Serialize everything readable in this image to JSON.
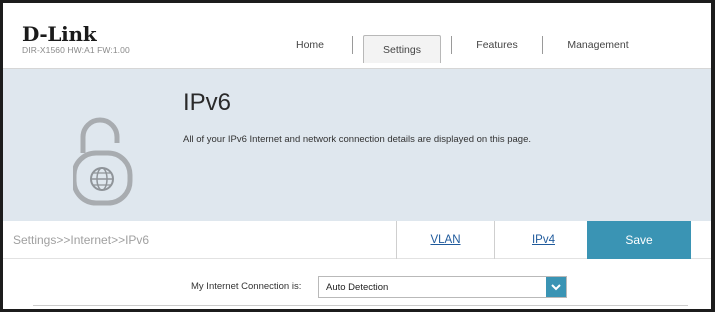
{
  "header": {
    "logo_text": "D-Link",
    "model_text": "DIR-X1560 HW:A1 FW:1.00",
    "nav": {
      "home": "Home",
      "settings": "Settings",
      "features": "Features",
      "management": "Management"
    },
    "active_tab": "Settings"
  },
  "banner": {
    "title": "IPv6",
    "description": "All of your IPv6 Internet and network connection details are displayed on this page.",
    "icon": "padlock-globe-icon"
  },
  "toolbar": {
    "breadcrumb": "Settings>>Internet>>IPv6",
    "vlan_label": "VLAN",
    "ipv4_label": "IPv4",
    "save_label": "Save"
  },
  "form": {
    "connection_label": "My Internet Connection is:",
    "connection_value": "Auto Detection"
  },
  "colors": {
    "accent": "#3a94b4",
    "banner_bg": "#dfe7ee",
    "link": "#1f5a9c"
  }
}
